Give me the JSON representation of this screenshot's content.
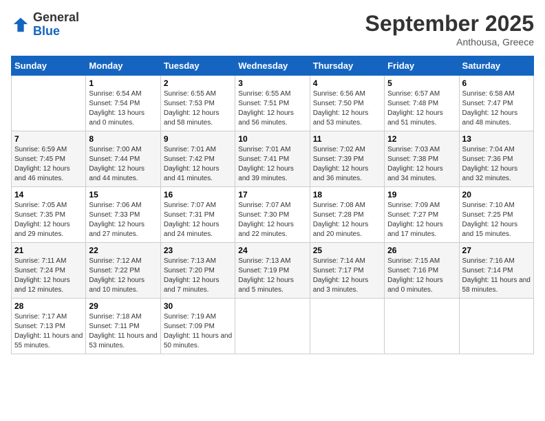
{
  "logo": {
    "general": "General",
    "blue": "Blue"
  },
  "header": {
    "title": "September 2025",
    "subtitle": "Anthousa, Greece"
  },
  "days_of_week": [
    "Sunday",
    "Monday",
    "Tuesday",
    "Wednesday",
    "Thursday",
    "Friday",
    "Saturday"
  ],
  "weeks": [
    [
      {
        "day": "",
        "sunrise": "",
        "sunset": "",
        "daylight": ""
      },
      {
        "day": "1",
        "sunrise": "Sunrise: 6:54 AM",
        "sunset": "Sunset: 7:54 PM",
        "daylight": "Daylight: 13 hours and 0 minutes."
      },
      {
        "day": "2",
        "sunrise": "Sunrise: 6:55 AM",
        "sunset": "Sunset: 7:53 PM",
        "daylight": "Daylight: 12 hours and 58 minutes."
      },
      {
        "day": "3",
        "sunrise": "Sunrise: 6:55 AM",
        "sunset": "Sunset: 7:51 PM",
        "daylight": "Daylight: 12 hours and 56 minutes."
      },
      {
        "day": "4",
        "sunrise": "Sunrise: 6:56 AM",
        "sunset": "Sunset: 7:50 PM",
        "daylight": "Daylight: 12 hours and 53 minutes."
      },
      {
        "day": "5",
        "sunrise": "Sunrise: 6:57 AM",
        "sunset": "Sunset: 7:48 PM",
        "daylight": "Daylight: 12 hours and 51 minutes."
      },
      {
        "day": "6",
        "sunrise": "Sunrise: 6:58 AM",
        "sunset": "Sunset: 7:47 PM",
        "daylight": "Daylight: 12 hours and 48 minutes."
      }
    ],
    [
      {
        "day": "7",
        "sunrise": "Sunrise: 6:59 AM",
        "sunset": "Sunset: 7:45 PM",
        "daylight": "Daylight: 12 hours and 46 minutes."
      },
      {
        "day": "8",
        "sunrise": "Sunrise: 7:00 AM",
        "sunset": "Sunset: 7:44 PM",
        "daylight": "Daylight: 12 hours and 44 minutes."
      },
      {
        "day": "9",
        "sunrise": "Sunrise: 7:01 AM",
        "sunset": "Sunset: 7:42 PM",
        "daylight": "Daylight: 12 hours and 41 minutes."
      },
      {
        "day": "10",
        "sunrise": "Sunrise: 7:01 AM",
        "sunset": "Sunset: 7:41 PM",
        "daylight": "Daylight: 12 hours and 39 minutes."
      },
      {
        "day": "11",
        "sunrise": "Sunrise: 7:02 AM",
        "sunset": "Sunset: 7:39 PM",
        "daylight": "Daylight: 12 hours and 36 minutes."
      },
      {
        "day": "12",
        "sunrise": "Sunrise: 7:03 AM",
        "sunset": "Sunset: 7:38 PM",
        "daylight": "Daylight: 12 hours and 34 minutes."
      },
      {
        "day": "13",
        "sunrise": "Sunrise: 7:04 AM",
        "sunset": "Sunset: 7:36 PM",
        "daylight": "Daylight: 12 hours and 32 minutes."
      }
    ],
    [
      {
        "day": "14",
        "sunrise": "Sunrise: 7:05 AM",
        "sunset": "Sunset: 7:35 PM",
        "daylight": "Daylight: 12 hours and 29 minutes."
      },
      {
        "day": "15",
        "sunrise": "Sunrise: 7:06 AM",
        "sunset": "Sunset: 7:33 PM",
        "daylight": "Daylight: 12 hours and 27 minutes."
      },
      {
        "day": "16",
        "sunrise": "Sunrise: 7:07 AM",
        "sunset": "Sunset: 7:31 PM",
        "daylight": "Daylight: 12 hours and 24 minutes."
      },
      {
        "day": "17",
        "sunrise": "Sunrise: 7:07 AM",
        "sunset": "Sunset: 7:30 PM",
        "daylight": "Daylight: 12 hours and 22 minutes."
      },
      {
        "day": "18",
        "sunrise": "Sunrise: 7:08 AM",
        "sunset": "Sunset: 7:28 PM",
        "daylight": "Daylight: 12 hours and 20 minutes."
      },
      {
        "day": "19",
        "sunrise": "Sunrise: 7:09 AM",
        "sunset": "Sunset: 7:27 PM",
        "daylight": "Daylight: 12 hours and 17 minutes."
      },
      {
        "day": "20",
        "sunrise": "Sunrise: 7:10 AM",
        "sunset": "Sunset: 7:25 PM",
        "daylight": "Daylight: 12 hours and 15 minutes."
      }
    ],
    [
      {
        "day": "21",
        "sunrise": "Sunrise: 7:11 AM",
        "sunset": "Sunset: 7:24 PM",
        "daylight": "Daylight: 12 hours and 12 minutes."
      },
      {
        "day": "22",
        "sunrise": "Sunrise: 7:12 AM",
        "sunset": "Sunset: 7:22 PM",
        "daylight": "Daylight: 12 hours and 10 minutes."
      },
      {
        "day": "23",
        "sunrise": "Sunrise: 7:13 AM",
        "sunset": "Sunset: 7:20 PM",
        "daylight": "Daylight: 12 hours and 7 minutes."
      },
      {
        "day": "24",
        "sunrise": "Sunrise: 7:13 AM",
        "sunset": "Sunset: 7:19 PM",
        "daylight": "Daylight: 12 hours and 5 minutes."
      },
      {
        "day": "25",
        "sunrise": "Sunrise: 7:14 AM",
        "sunset": "Sunset: 7:17 PM",
        "daylight": "Daylight: 12 hours and 3 minutes."
      },
      {
        "day": "26",
        "sunrise": "Sunrise: 7:15 AM",
        "sunset": "Sunset: 7:16 PM",
        "daylight": "Daylight: 12 hours and 0 minutes."
      },
      {
        "day": "27",
        "sunrise": "Sunrise: 7:16 AM",
        "sunset": "Sunset: 7:14 PM",
        "daylight": "Daylight: 11 hours and 58 minutes."
      }
    ],
    [
      {
        "day": "28",
        "sunrise": "Sunrise: 7:17 AM",
        "sunset": "Sunset: 7:13 PM",
        "daylight": "Daylight: 11 hours and 55 minutes."
      },
      {
        "day": "29",
        "sunrise": "Sunrise: 7:18 AM",
        "sunset": "Sunset: 7:11 PM",
        "daylight": "Daylight: 11 hours and 53 minutes."
      },
      {
        "day": "30",
        "sunrise": "Sunrise: 7:19 AM",
        "sunset": "Sunset: 7:09 PM",
        "daylight": "Daylight: 11 hours and 50 minutes."
      },
      {
        "day": "",
        "sunrise": "",
        "sunset": "",
        "daylight": ""
      },
      {
        "day": "",
        "sunrise": "",
        "sunset": "",
        "daylight": ""
      },
      {
        "day": "",
        "sunrise": "",
        "sunset": "",
        "daylight": ""
      },
      {
        "day": "",
        "sunrise": "",
        "sunset": "",
        "daylight": ""
      }
    ]
  ]
}
